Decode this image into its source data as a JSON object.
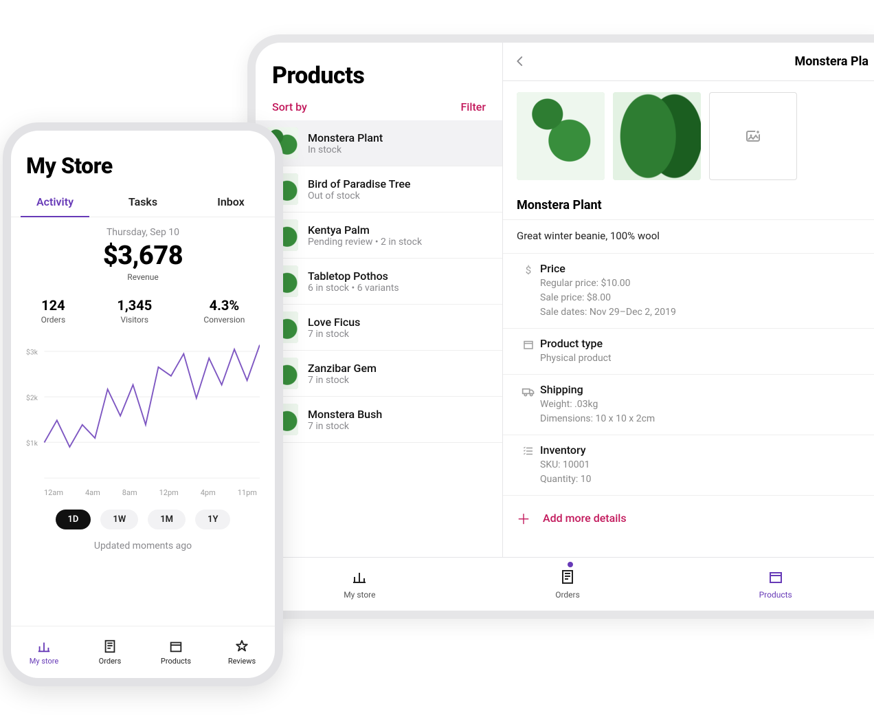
{
  "tablet": {
    "products_title": "Products",
    "sort_label": "Sort by",
    "filter_label": "Filter",
    "items": [
      {
        "name": "Monstera Plant",
        "sub": "In stock"
      },
      {
        "name": "Bird of Paradise Tree",
        "sub": "Out of stock"
      },
      {
        "name": "Kentya Palm",
        "sub": "Pending review • 2 in stock"
      },
      {
        "name": "Tabletop Pothos",
        "sub": "6 in stock • 6 variants"
      },
      {
        "name": "Love Ficus",
        "sub": "7 in stock"
      },
      {
        "name": "Zanzibar Gem",
        "sub": "7 in stock"
      },
      {
        "name": "Monstera Bush",
        "sub": "7 in stock"
      }
    ],
    "detail": {
      "header_title": "Monstera Pla",
      "name": "Monstera Plant",
      "description": "Great winter beanie, 100% wool",
      "price_title": "Price",
      "price_regular": "Regular price: $10.00",
      "price_sale": "Sale price: $8.00",
      "price_dates": "Sale dates: Nov 29–Dec 2, 2019",
      "producttype_title": "Product type",
      "producttype_value": "Physical product",
      "shipping_title": "Shipping",
      "shipping_weight": "Weight: .03kg",
      "shipping_dim": "Dimensions: 10 x 10 x 2cm",
      "inventory_title": "Inventory",
      "inventory_sku": "SKU: 10001",
      "inventory_qty": "Quantity: 10",
      "add_more": "Add more details"
    },
    "nav": {
      "mystore": "My store",
      "orders": "Orders",
      "products": "Products"
    }
  },
  "phone": {
    "title": "My Store",
    "tabs": {
      "activity": "Activity",
      "tasks": "Tasks",
      "inbox": "Inbox"
    },
    "date": "Thursday, Sep 10",
    "revenue": "$3,678",
    "revenue_label": "Revenue",
    "stats": {
      "orders_val": "124",
      "orders_lbl": "Orders",
      "visitors_val": "1,345",
      "visitors_lbl": "Visitors",
      "conversion_val": "4.3%",
      "conversion_lbl": "Conversion"
    },
    "ranges": {
      "d1": "1D",
      "w1": "1W",
      "m1": "1M",
      "y1": "1Y"
    },
    "updated": "Updated moments ago",
    "nav": {
      "mystore": "My store",
      "orders": "Orders",
      "products": "Products",
      "reviews": "Reviews"
    }
  },
  "chart_data": {
    "type": "line",
    "title": "",
    "xlabel": "",
    "ylabel": "",
    "ylim": [
      0,
      3000
    ],
    "y_ticks": [
      "$1k",
      "$2k",
      "$3k"
    ],
    "categories": [
      "12am",
      "4am",
      "8am",
      "12pm",
      "4pm",
      "11pm"
    ],
    "values": [
      800,
      1300,
      700,
      1200,
      900,
      2000,
      1400,
      2100,
      1200,
      2500,
      2300,
      2800,
      1800,
      2700,
      2100,
      2900,
      2200,
      3000
    ]
  }
}
